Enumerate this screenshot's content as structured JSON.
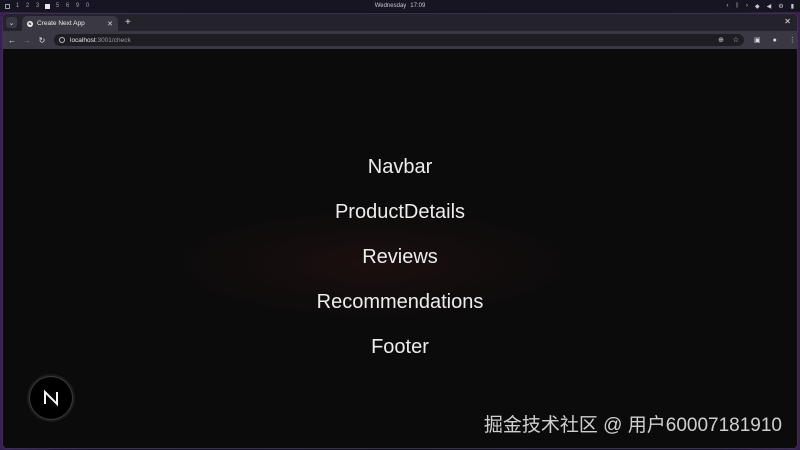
{
  "os_bar": {
    "workspaces": [
      "1",
      "2",
      "3",
      "",
      "5",
      "6",
      "9",
      "0"
    ],
    "active_workspace_index": 3,
    "clock": {
      "day": "Wednesday",
      "time": "17:09"
    }
  },
  "browser": {
    "tab": {
      "title": "Create Next App",
      "favicon_letter": "N"
    },
    "address": {
      "host": "localhost",
      "path": ":3001/check"
    }
  },
  "page": {
    "sections": [
      "Navbar",
      "ProductDetails",
      "Reviews",
      "Recommendations",
      "Footer"
    ],
    "dev_badge_letter": "N"
  },
  "watermark": "掘金技术社区 @ 用户60007181910",
  "colors": {
    "page_background": "#0c0b0b",
    "heading_text": "#ededed",
    "browser_frame": "#3a3842"
  }
}
